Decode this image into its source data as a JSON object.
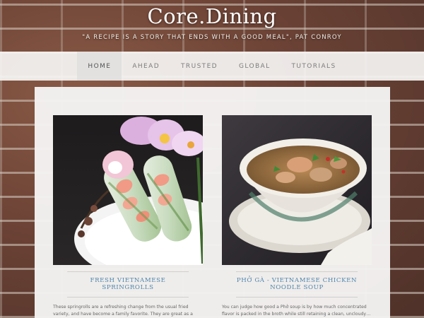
{
  "site": {
    "title": "Core.Dining",
    "tagline": "\"A recipe is a story that ends with a good meal\", Pat Conroy"
  },
  "nav": {
    "items": [
      {
        "label": "Home",
        "active": true
      },
      {
        "label": "Ahead"
      },
      {
        "label": "Trusted"
      },
      {
        "label": "Global"
      },
      {
        "label": "Tutorials"
      }
    ]
  },
  "posts": [
    {
      "title": "Fresh Vietnamese Springrolls",
      "excerpt": "These springrolls are a refreshing change from the usual fried variety, and have become a family favorite. They are great as a cool…"
    },
    {
      "title": "Phở Gà - Vietnamese Chicken Noodle Soup",
      "excerpt": "You can judge how good a Phở soup is by how much concentrated flavor is packed in the broth while still retaining a clean, uncloudy…"
    }
  ],
  "colors": {
    "link": "#4f85ad",
    "nav_bg": "#f5f4f3",
    "panel_bg": "#f4f3f2"
  }
}
